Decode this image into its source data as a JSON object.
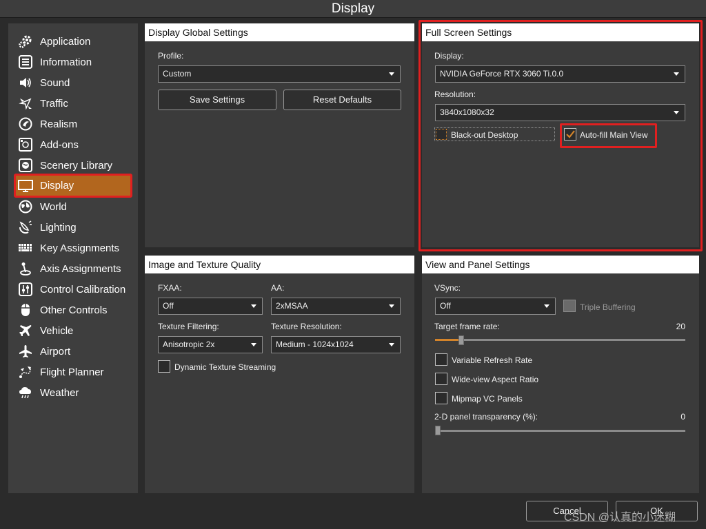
{
  "window": {
    "title": "Display"
  },
  "sidebar": {
    "items": [
      {
        "label": "Application",
        "icon": "gear-icon"
      },
      {
        "label": "Information",
        "icon": "list-icon"
      },
      {
        "label": "Sound",
        "icon": "speaker-icon"
      },
      {
        "label": "Traffic",
        "icon": "traffic-icon"
      },
      {
        "label": "Realism",
        "icon": "realism-icon"
      },
      {
        "label": "Add-ons",
        "icon": "addons-icon"
      },
      {
        "label": "Scenery Library",
        "icon": "globe-icon"
      },
      {
        "label": "Display",
        "icon": "monitor-icon",
        "active": true
      },
      {
        "label": "World",
        "icon": "world-icon"
      },
      {
        "label": "Lighting",
        "icon": "lighting-icon"
      },
      {
        "label": "Key Assignments",
        "icon": "keyboard-icon"
      },
      {
        "label": "Axis Assignments",
        "icon": "joystick-icon"
      },
      {
        "label": "Control Calibration",
        "icon": "sliders-icon"
      },
      {
        "label": "Other Controls",
        "icon": "mouse-icon"
      },
      {
        "label": "Vehicle",
        "icon": "plane-icon"
      },
      {
        "label": "Airport",
        "icon": "airport-icon"
      },
      {
        "label": "Flight Planner",
        "icon": "route-icon"
      },
      {
        "label": "Weather",
        "icon": "cloud-icon"
      }
    ]
  },
  "global_settings": {
    "header": "Display Global Settings",
    "profile_label": "Profile:",
    "profile_value": "Custom",
    "save_label": "Save Settings",
    "reset_label": "Reset Defaults"
  },
  "fullscreen": {
    "header": "Full Screen Settings",
    "display_label": "Display:",
    "display_value": "NVIDIA GeForce RTX 3060 Ti.0.0",
    "resolution_label": "Resolution:",
    "resolution_value": "3840x1080x32",
    "blackout_label": "Black-out Desktop",
    "blackout_checked": false,
    "autofill_label": "Auto-fill Main View",
    "autofill_checked": true
  },
  "texture": {
    "header": "Image and Texture Quality",
    "fxaa_label": "FXAA:",
    "fxaa_value": "Off",
    "aa_label": "AA:",
    "aa_value": "2xMSAA",
    "filtering_label": "Texture Filtering:",
    "filtering_value": "Anisotropic 2x",
    "resolution_label": "Texture Resolution:",
    "resolution_value": "Medium - 1024x1024",
    "streaming_label": "Dynamic Texture Streaming",
    "streaming_checked": false
  },
  "view_panel": {
    "header": "View and Panel Settings",
    "vsync_label": "VSync:",
    "vsync_value": "Off",
    "triple_label": "Triple Buffering",
    "frame_rate_label": "Target frame rate:",
    "frame_rate_value": "20",
    "frame_rate_fraction": 0.1,
    "variable_refresh_label": "Variable Refresh Rate",
    "wideview_label": "Wide-view Aspect Ratio",
    "mipmap_label": "Mipmap VC Panels",
    "transparency_label": "2-D panel transparency (%):",
    "transparency_value": "0"
  },
  "footer": {
    "cancel_label": "Cancel",
    "ok_label": "OK"
  },
  "watermark": "CSDN @认真的小迷糊",
  "colors": {
    "accent": "#b2661e",
    "highlight": "#e02020",
    "slider": "#d4842a"
  }
}
